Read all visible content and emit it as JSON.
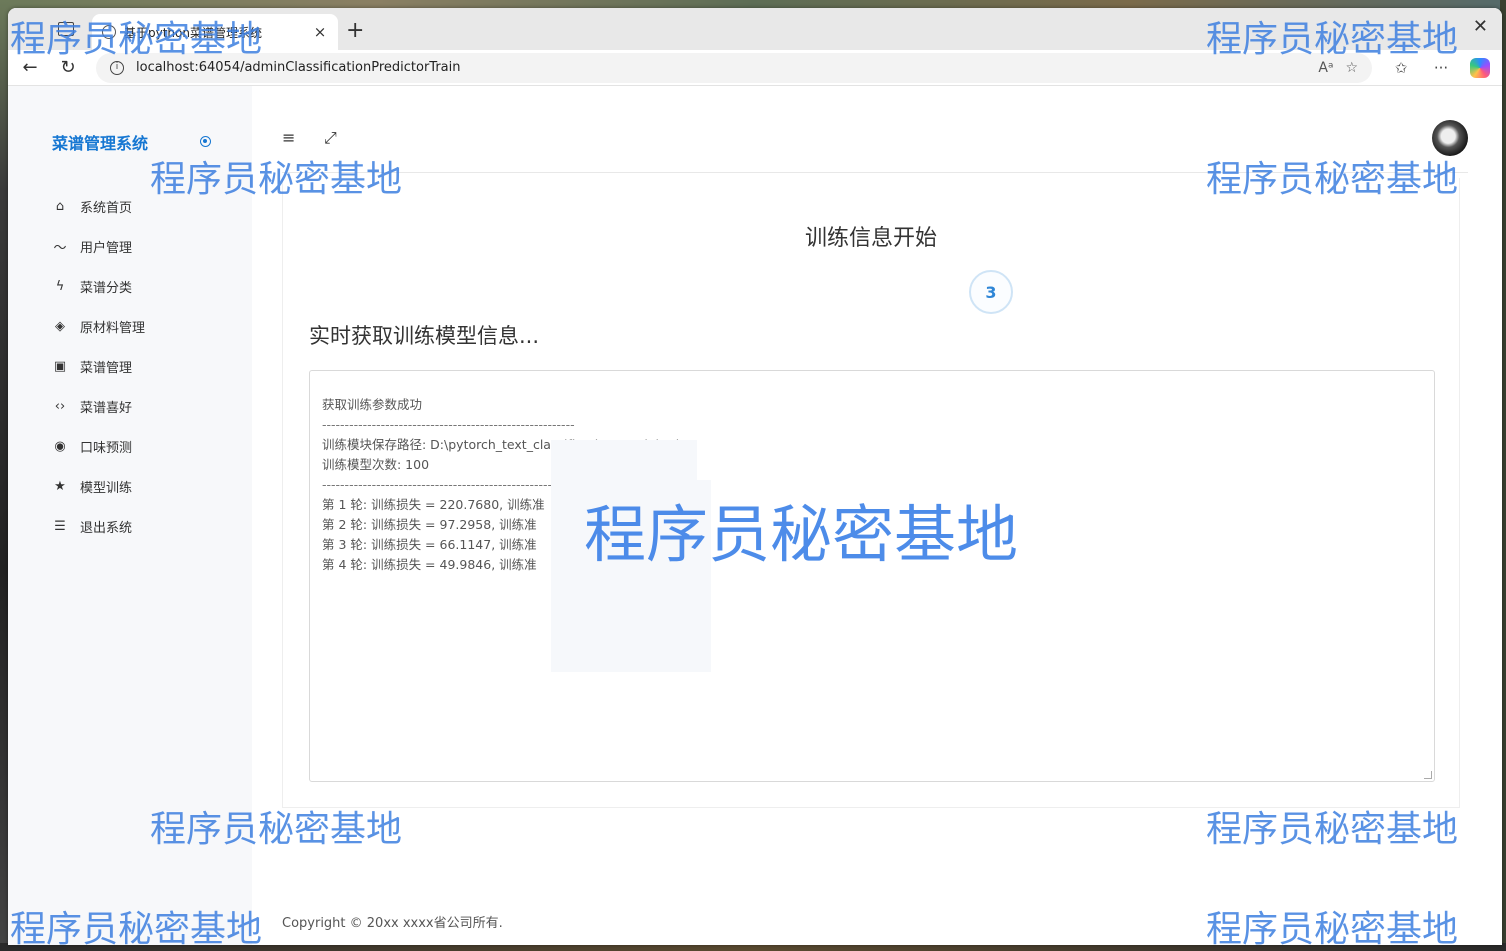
{
  "browser": {
    "tab_title": "基于python菜谱管理系统",
    "tab_close": "×",
    "new_tab": "+",
    "window_close": "✕",
    "url": "localhost:64054/adminClassificationPredictorTrain"
  },
  "sidebar": {
    "brand": "菜谱管理系统",
    "items": [
      {
        "label": "系统首页",
        "icon": "home-icon",
        "glyph": "⌂"
      },
      {
        "label": "用户管理",
        "icon": "trend-icon",
        "glyph": "〜"
      },
      {
        "label": "菜谱分类",
        "icon": "bolt-icon",
        "glyph": "ϟ"
      },
      {
        "label": "原材料管理",
        "icon": "layers-icon",
        "glyph": "◈"
      },
      {
        "label": "菜谱管理",
        "icon": "inbox-icon",
        "glyph": "▣"
      },
      {
        "label": "菜谱喜好",
        "icon": "code-icon",
        "glyph": "‹›"
      },
      {
        "label": "口味预测",
        "icon": "target-icon",
        "glyph": "◉"
      },
      {
        "label": "模型训练",
        "icon": "star-icon",
        "glyph": "★"
      },
      {
        "label": "退出系统",
        "icon": "list-icon",
        "glyph": "☰"
      }
    ]
  },
  "header": {
    "menu_toggle_glyph": "≡",
    "fullscreen_glyph": "⤢"
  },
  "training": {
    "title": "训练信息开始",
    "counter": "3",
    "realtime_heading": "实时获取训练模型信息...",
    "log": {
      "line1": "获取训练参数成功",
      "dash1": "--------------------------------------------------------",
      "save_path": "训练模块保存路径:  D:\\pytorch_text_classification_model.pth",
      "epochs": "训练模型次数:  100",
      "dash2": "--------------------------------------------------------",
      "epochs_log": [
        "第 1 轮: 训练损失 = 220.7680, 训练准",
        "第 2 轮: 训练损失 = 97.2958, 训练准",
        "第 3 轮: 训练损失 = 66.1147, 训练准",
        "第 4 轮: 训练损失 = 49.9846, 训练准"
      ]
    }
  },
  "footer": {
    "copyright": "Copyright © 20xx xxxx省公司所有."
  },
  "watermark": "程序员秘密基地",
  "colors": {
    "brand": "#1677d2",
    "watermark": "#3d7fe0",
    "counter": "#2f86d6"
  }
}
